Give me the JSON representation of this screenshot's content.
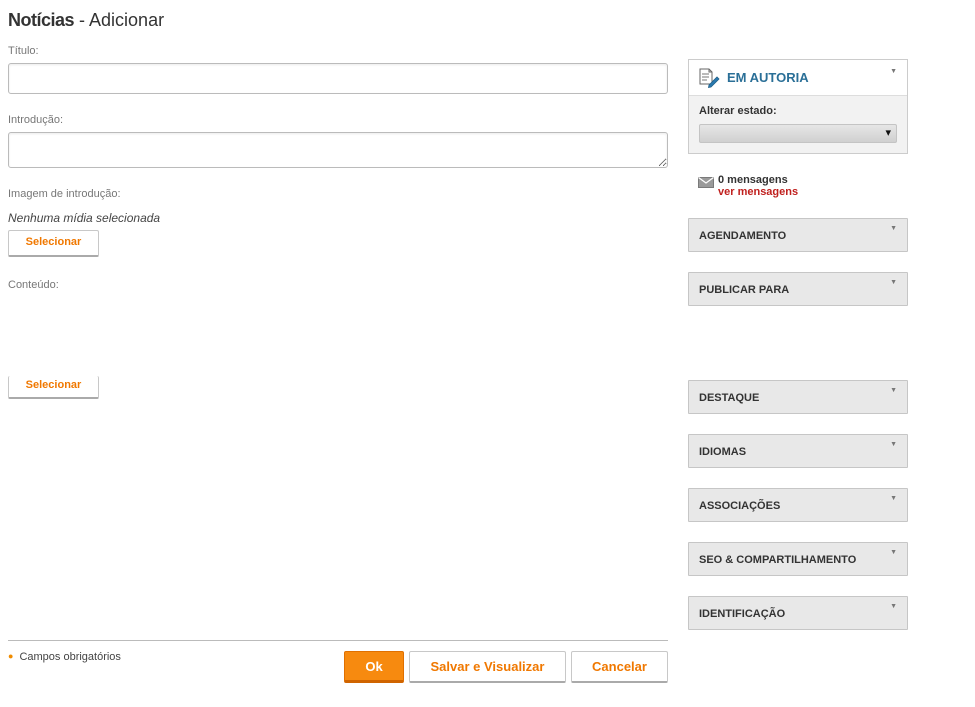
{
  "page": {
    "title_bold": "Notícias",
    "title_rest": " - Adicionar"
  },
  "form": {
    "title_label": "Título:",
    "title_value": "",
    "intro_label": "Introdução:",
    "intro_value": "",
    "intro_image_label": "Imagem de introdução:",
    "no_media_text": "Nenhuma mídia selecionada",
    "select_button_1": "Selecionar",
    "content_label": "Conteúdo:",
    "select_button_2": "Selecionar"
  },
  "footer": {
    "required_note": "Campos obrigatórios",
    "ok_label": "Ok",
    "save_view_label": "Salvar e Visualizar",
    "cancel_label": "Cancelar"
  },
  "sidebar": {
    "status_panel": {
      "title": "EM AUTORIA",
      "change_state_label": "Alterar estado:",
      "state_value": ""
    },
    "messages": {
      "count_text": "0 mensagens",
      "link_text": "ver mensagens"
    },
    "sections": [
      "AGENDAMENTO",
      "PUBLICAR PARA",
      "DESTAQUE",
      "IDIOMAS",
      "ASSOCIAÇÕES",
      "SEO & COMPARTILHAMENTO",
      "IDENTIFICAÇÃO"
    ]
  },
  "colors": {
    "accent": "#f78a0f",
    "link_red": "#c0201e",
    "status_blue": "#2a6f97"
  },
  "icons": {
    "status": "document-pencil-icon",
    "messages": "envelope-icon",
    "collapse": "triangle-down-icon"
  }
}
